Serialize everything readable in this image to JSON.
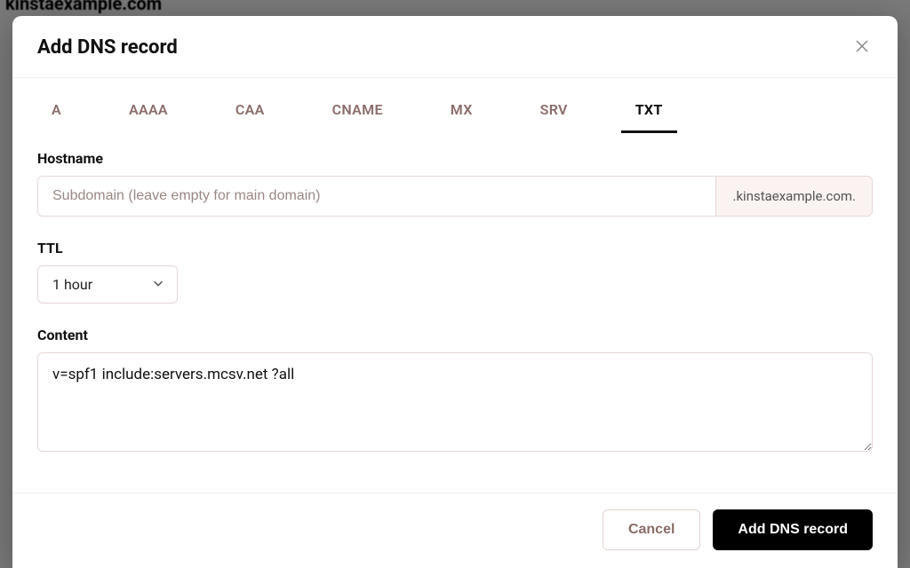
{
  "background_heading": "kinstaexample.com",
  "modal": {
    "title": "Add DNS record",
    "tabs": [
      "A",
      "AAAA",
      "CAA",
      "CNAME",
      "MX",
      "SRV",
      "TXT"
    ],
    "active_tab": "TXT",
    "hostname": {
      "label": "Hostname",
      "placeholder": "Subdomain (leave empty for main domain)",
      "value": "",
      "suffix": ".kinstaexample.com."
    },
    "ttl": {
      "label": "TTL",
      "value": "1 hour"
    },
    "content": {
      "label": "Content",
      "value": "v=spf1 include:servers.mcsv.net ?all"
    },
    "buttons": {
      "cancel": "Cancel",
      "submit": "Add DNS record"
    }
  }
}
